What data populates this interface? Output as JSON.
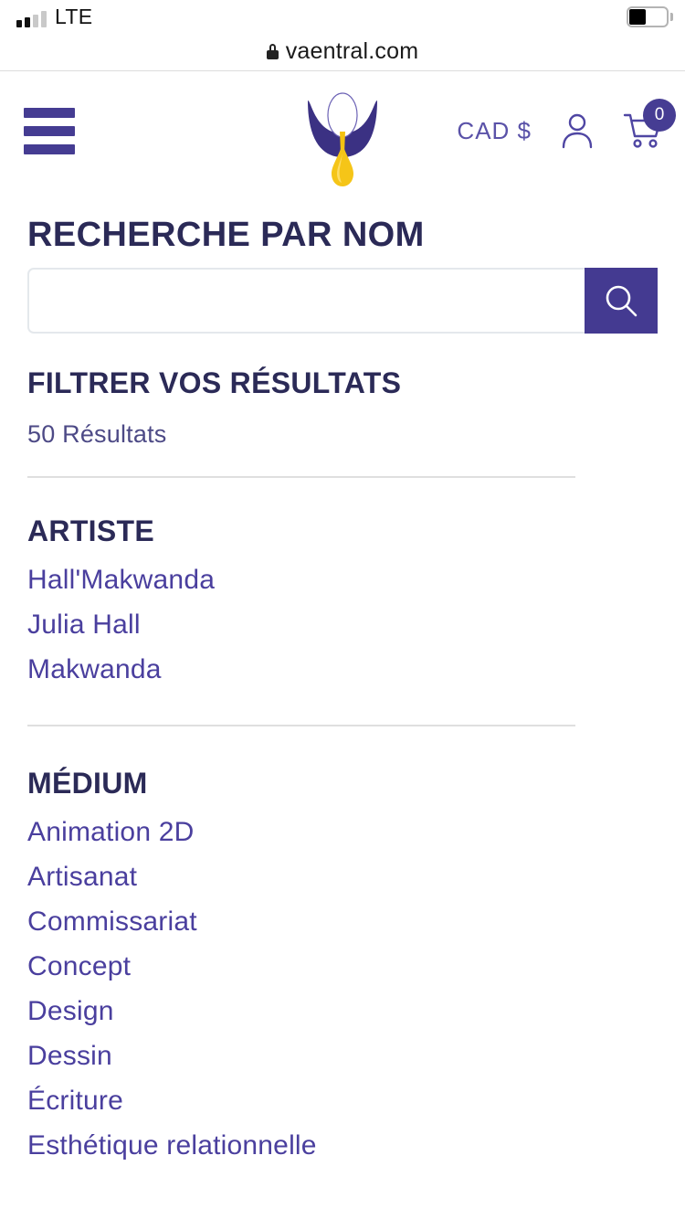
{
  "status_bar": {
    "carrier": "LTE",
    "signal_bars_active": 2,
    "signal_bars_total": 4,
    "battery_level_pct": 40
  },
  "browser": {
    "url": "vaentral.com",
    "lock_icon": "lock-icon"
  },
  "header": {
    "menu_icon": "hamburger-menu-icon",
    "logo_alt": "vaentral-logo",
    "currency_label": "CAD $",
    "account_icon": "user-account-icon",
    "cart_icon": "shopping-cart-icon",
    "cart_count": "0"
  },
  "search": {
    "title": "RECHERCHE PAR NOM",
    "value": "",
    "placeholder": "",
    "button_icon": "search-icon"
  },
  "filters": {
    "title": "FILTRER VOS RÉSULTATS",
    "results_count": "50 Résultats",
    "facets": [
      {
        "title": "ARTISTE",
        "options": [
          "Hall'Makwanda",
          "Julia Hall",
          "Makwanda"
        ]
      },
      {
        "title": "MÉDIUM",
        "options": [
          "Animation 2D",
          "Artisanat",
          "Commissariat",
          "Concept",
          "Design",
          "Dessin",
          "Écriture",
          "Esthétique relationnelle"
        ]
      }
    ]
  },
  "colors": {
    "brand_purple": "#443a91",
    "heading_navy": "#2b2a57",
    "link_purple": "#4a3f9e",
    "accent_yellow": "#f5c518",
    "divider_gray": "#dfdfdf"
  }
}
